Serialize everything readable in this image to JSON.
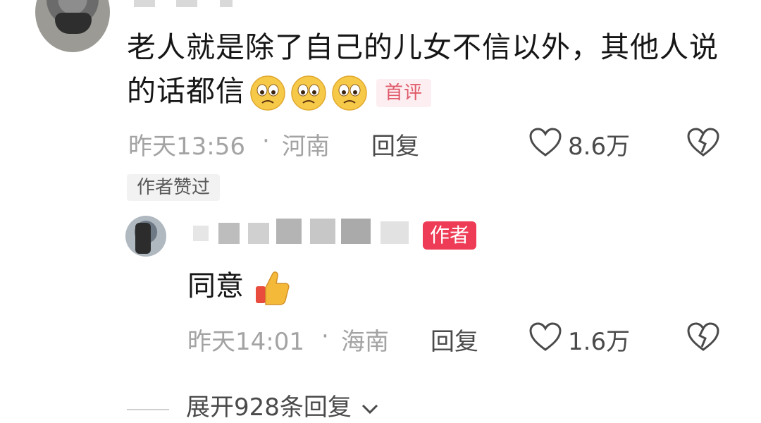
{
  "comment": {
    "text": "老人就是除了自己的儿女不信以外，其他人说的话都信",
    "emojis": [
      "frown-face",
      "frown-face",
      "frown-face"
    ],
    "badge": "首评",
    "time": "昨天13:56",
    "separator": "·",
    "location": "河南",
    "reply_label": "回复",
    "likes": "8.6万",
    "author_liked": "作者赞过"
  },
  "reply": {
    "author_badge": "作者",
    "text": "同意",
    "emoji": "thumbs-up",
    "time": "昨天14:01",
    "separator": "·",
    "location": "海南",
    "reply_label": "回复",
    "likes": "1.6万"
  },
  "expand": {
    "label": "展开928条回复"
  },
  "colors": {
    "badge_red": "#ee3b56",
    "first_badge_text": "#e05a6b",
    "meta_gray": "#a3a3a3"
  }
}
